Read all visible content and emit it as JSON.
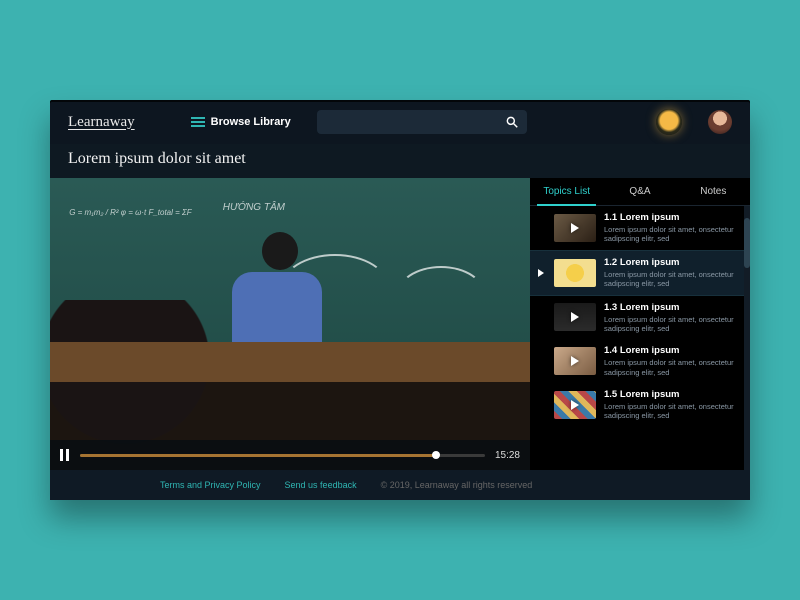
{
  "header": {
    "logo": "Learnaway",
    "browse_label": "Browse Library",
    "search_placeholder": ""
  },
  "lesson": {
    "title": "Lorem ipsum dolor sit amet"
  },
  "player": {
    "duration_label": "15:28",
    "chalk_title": "HƯỚNG TÂM",
    "chalk_notes": "G = m₁m₂ / R²\nφ = ω·t\nF_total = ΣF"
  },
  "sidebar": {
    "tabs": [
      {
        "label": "Topics List",
        "active": true
      },
      {
        "label": "Q&A",
        "active": false
      },
      {
        "label": "Notes",
        "active": false
      }
    ],
    "topics": [
      {
        "title": "1.1 Lorem ipsum",
        "desc": "Lorem ipsum dolor sit amet, onsectetur sadipscing elitr, sed"
      },
      {
        "title": "1.2 Lorem ipsum",
        "desc": "Lorem ipsum dolor sit amet, onsectetur sadipscing elitr, sed"
      },
      {
        "title": "1.3 Lorem ipsum",
        "desc": "Lorem ipsum dolor sit amet, onsectetur sadipscing elitr, sed"
      },
      {
        "title": "1.4 Lorem ipsum",
        "desc": "Lorem ipsum dolor sit amet, onsectetur sadipscing elitr, sed"
      },
      {
        "title": "1.5 Lorem ipsum",
        "desc": "Lorem ipsum dolor sit amet, onsectetur sadipscing elitr, sed"
      }
    ]
  },
  "footer": {
    "terms": "Terms and Privacy Policy",
    "feedback": "Send us feedback",
    "copyright": "© 2019,  Learnaway all rights reserved"
  }
}
